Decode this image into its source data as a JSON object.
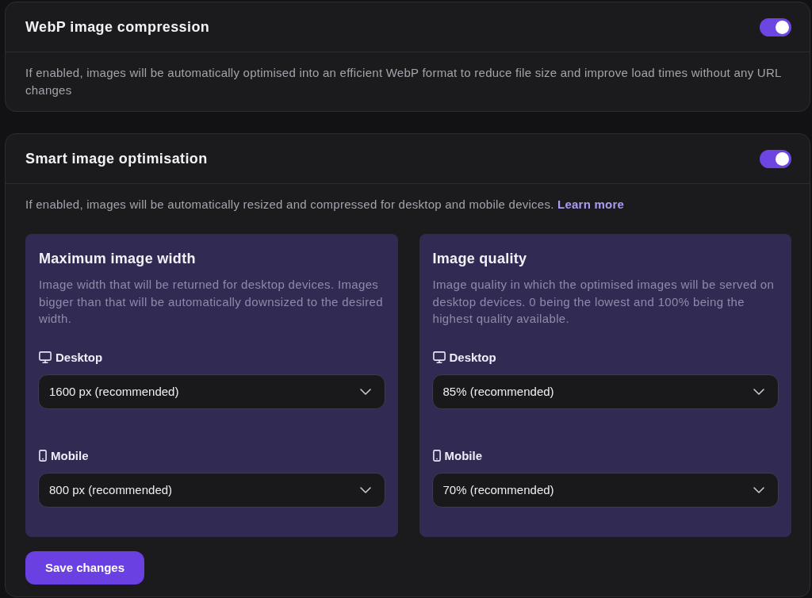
{
  "sections": [
    {
      "title": "WebP image compression",
      "on": true,
      "description": "If enabled, images will be automatically optimised into an efficient WebP format to reduce file size and improve load times without any URL changes"
    },
    {
      "title": "Smart image optimisation",
      "on": true,
      "description": "If enabled, images will be automatically resized and compressed for desktop and mobile devices.",
      "link": "Learn more",
      "panels": [
        {
          "title": "Maximum image width",
          "description": "Image width that will be returned for desktop devices. Images bigger than that will be automatically downsized to the desired width.",
          "fields": [
            {
              "kind": "desktop",
              "label": "Desktop",
              "value": "1600 px (recommended)"
            },
            {
              "kind": "mobile",
              "label": "Mobile",
              "value": "800 px (recommended)"
            }
          ]
        },
        {
          "title": "Image quality",
          "description": "Image quality in which the optimised images will be served on desktop devices. 0 being the lowest and 100% being the highest quality available.",
          "fields": [
            {
              "kind": "desktop",
              "label": "Desktop",
              "value": "85% (recommended)"
            },
            {
              "kind": "mobile",
              "label": "Mobile",
              "value": "70% (recommended)"
            }
          ]
        }
      ],
      "save_button": "Save changes"
    }
  ]
}
